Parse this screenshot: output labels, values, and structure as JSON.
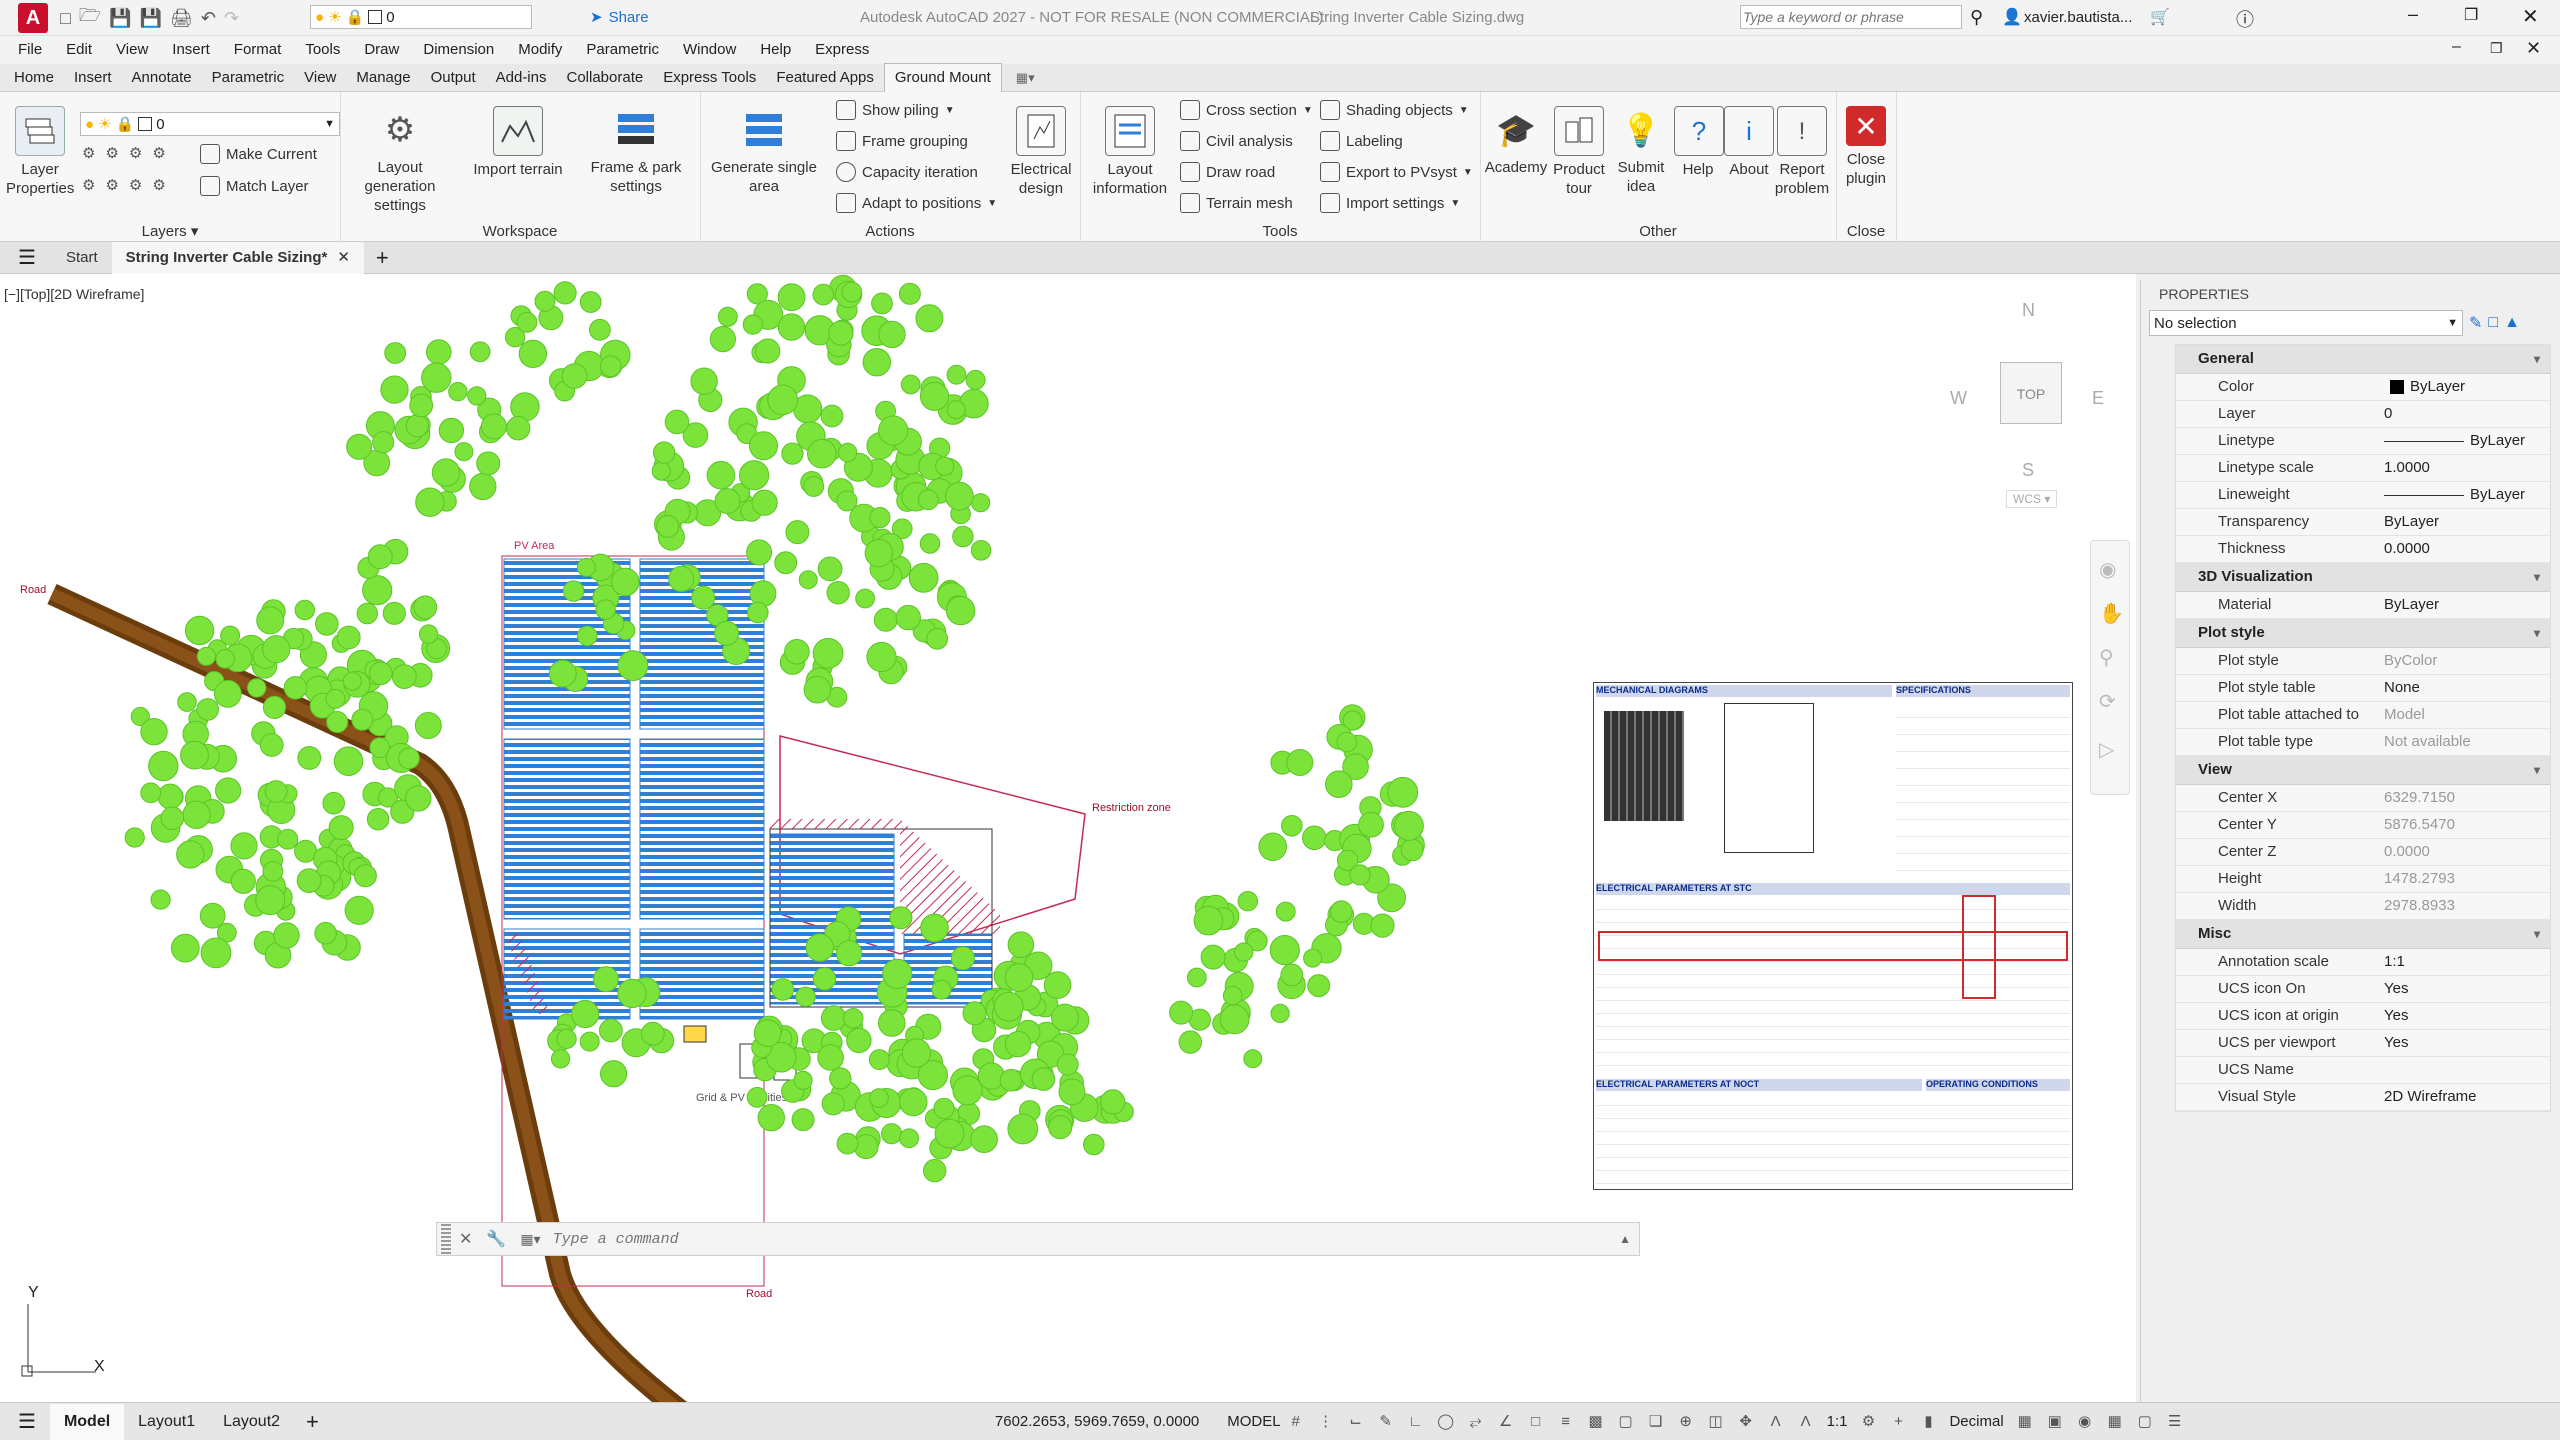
{
  "titlebar": {
    "app_icon": "A",
    "workspace_value": "0",
    "share": "Share",
    "title": "Autodesk AutoCAD 2027 - NOT FOR RESALE (NON COMMERCIAL)",
    "filename": "String Inverter Cable Sizing.dwg",
    "search_placeholder": "Type a keyword or phrase",
    "user": "xavier.bautista..."
  },
  "menubar": [
    "File",
    "Edit",
    "View",
    "Insert",
    "Format",
    "Tools",
    "Draw",
    "Dimension",
    "Modify",
    "Parametric",
    "Window",
    "Help",
    "Express"
  ],
  "ribbon_tabs": [
    "Home",
    "Insert",
    "Annotate",
    "Parametric",
    "View",
    "Manage",
    "Output",
    "Add-ins",
    "Collaborate",
    "Express Tools",
    "Featured Apps",
    "Ground Mount"
  ],
  "ribbon": {
    "layers": {
      "label": "Layers",
      "layer_props": "Layer Properties",
      "layer_value": "0",
      "make_current": "Make Current",
      "match_layer": "Match Layer"
    },
    "workspace": {
      "label": "Workspace",
      "layout_gen": "Layout generation settings",
      "import_terrain": "Import terrain",
      "frame_park": "Frame & park settings"
    },
    "actions": {
      "label": "Actions",
      "gen_single": "Generate single area",
      "show_piling": "Show piling",
      "frame_grouping": "Frame grouping",
      "capacity_iteration": "Capacity iteration",
      "adapt_positions": "Adapt to positions",
      "electrical_design": "Electrical design"
    },
    "tools": {
      "label": "Tools",
      "layout_info": "Layout information",
      "cross_section": "Cross section",
      "civil_analysis": "Civil analysis",
      "draw_road": "Draw road",
      "terrain_mesh": "Terrain mesh",
      "shading_objects": "Shading objects",
      "labeling": "Labeling",
      "export_pvsyst": "Export to PVsyst",
      "import_settings": "Import settings"
    },
    "other": {
      "label": "Other",
      "academy": "Academy",
      "product_tour": "Product tour",
      "submit_idea": "Submit idea",
      "help": "Help",
      "about": "About",
      "report_problem": "Report problem"
    },
    "close": {
      "label": "Close",
      "close_plugin": "Close plugin"
    }
  },
  "doc_tabs": {
    "start": "Start",
    "active": "String Inverter Cable Sizing*"
  },
  "viewport": {
    "label": "[−][Top][2D Wireframe]",
    "viewcube": {
      "n": "N",
      "s": "S",
      "e": "E",
      "w": "W",
      "top": "TOP",
      "wcs": "WCS"
    },
    "labels": {
      "pv_area": "PV Area",
      "road_start": "Road",
      "road_end": "Road",
      "restriction": "Restriction zone",
      "facilities": "Grid & PV facilities"
    },
    "ucs": {
      "x": "X",
      "y": "Y"
    }
  },
  "datasheet": {
    "mech": "MECHANICAL DIAGRAMS",
    "specs": "SPECIFICATIONS",
    "elec_stc": "ELECTRICAL PARAMETERS AT STC",
    "elec_noct": "ELECTRICAL PARAMETERS AT NOCT",
    "operating": "OPERATING CONDITIONS"
  },
  "command": {
    "placeholder": "Type a command"
  },
  "properties": {
    "title": "PROPERTIES",
    "selection": "No selection",
    "sections": [
      {
        "name": "General",
        "rows": [
          {
            "k": "Color",
            "v": "ByLayer"
          },
          {
            "k": "Layer",
            "v": "0"
          },
          {
            "k": "Linetype",
            "v": "ByLayer"
          },
          {
            "k": "Linetype scale",
            "v": "1.0000"
          },
          {
            "k": "Lineweight",
            "v": "ByLayer"
          },
          {
            "k": "Transparency",
            "v": "ByLayer"
          },
          {
            "k": "Thickness",
            "v": "0.0000"
          }
        ]
      },
      {
        "name": "3D Visualization",
        "rows": [
          {
            "k": "Material",
            "v": "ByLayer"
          }
        ]
      },
      {
        "name": "Plot style",
        "rows": [
          {
            "k": "Plot style",
            "v": "ByColor"
          },
          {
            "k": "Plot style table",
            "v": "None"
          },
          {
            "k": "Plot table attached to",
            "v": "Model"
          },
          {
            "k": "Plot table type",
            "v": "Not available"
          }
        ]
      },
      {
        "name": "View",
        "rows": [
          {
            "k": "Center X",
            "v": "6329.7150"
          },
          {
            "k": "Center Y",
            "v": "5876.5470"
          },
          {
            "k": "Center Z",
            "v": "0.0000"
          },
          {
            "k": "Height",
            "v": "1478.2793"
          },
          {
            "k": "Width",
            "v": "2978.8933"
          }
        ]
      },
      {
        "name": "Misc",
        "rows": [
          {
            "k": "Annotation scale",
            "v": "1:1"
          },
          {
            "k": "UCS icon On",
            "v": "Yes"
          },
          {
            "k": "UCS icon at origin",
            "v": "Yes"
          },
          {
            "k": "UCS per viewport",
            "v": "Yes"
          },
          {
            "k": "UCS Name",
            "v": ""
          },
          {
            "k": "Visual Style",
            "v": "2D Wireframe"
          }
        ]
      }
    ]
  },
  "statusbar": {
    "tabs": [
      "Model",
      "Layout1",
      "Layout2"
    ],
    "coords": "7602.2653, 5969.7659, 0.0000",
    "mode": "MODEL",
    "scale": "1:1",
    "units": "Decimal"
  },
  "colors": {
    "tree": "#7be33a",
    "panel": "#2f7fd8",
    "road": "#7a4a12",
    "restriction": "#c62a52",
    "accent": "#1d6fd1"
  }
}
